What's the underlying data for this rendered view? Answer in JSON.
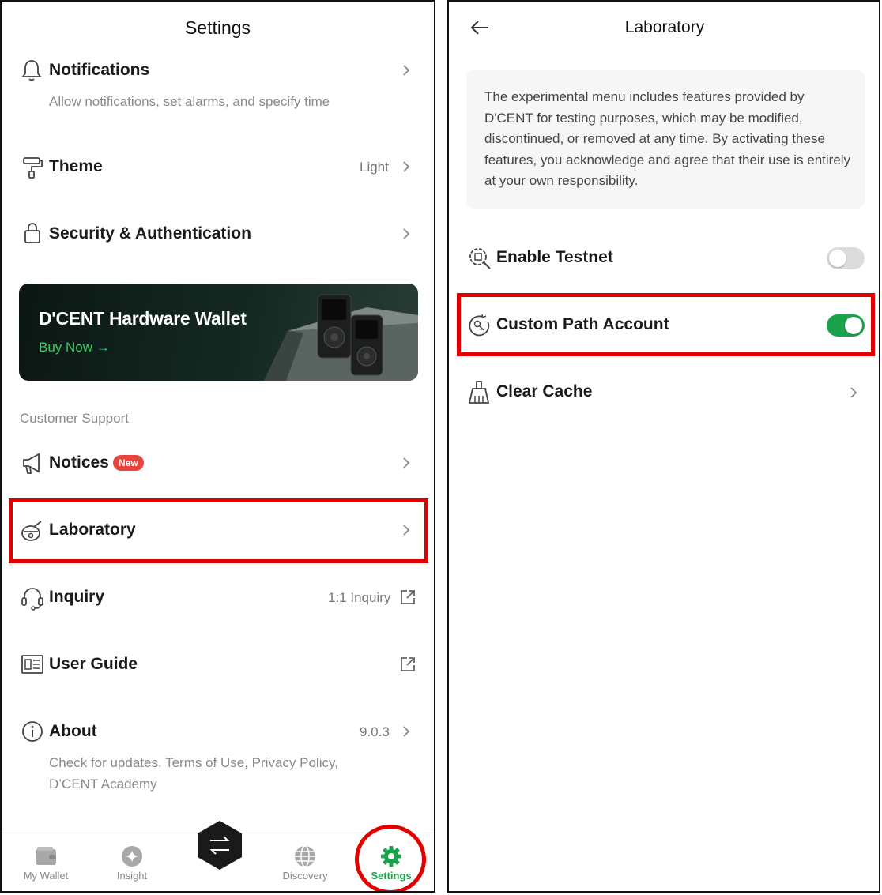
{
  "settings": {
    "title": "Settings",
    "notifications": {
      "label": "Notifications",
      "description": "Allow notifications, set alarms, and specify time"
    },
    "theme": {
      "label": "Theme",
      "value": "Light"
    },
    "security": {
      "label": "Security & Authentication"
    },
    "banner": {
      "title": "D'CENT Hardware Wallet",
      "cta": "Buy Now →"
    },
    "section_header": "Customer Support",
    "notices": {
      "label": "Notices",
      "badge": "New"
    },
    "laboratory": {
      "label": "Laboratory"
    },
    "inquiry": {
      "label": "Inquiry",
      "value": "1:1 Inquiry"
    },
    "user_guide": {
      "label": "User Guide"
    },
    "about": {
      "label": "About",
      "value": "9.0.3",
      "description": "Check for updates, Terms of Use, Privacy Policy, D’CENT Academy"
    }
  },
  "tabbar": {
    "my_wallet": "My Wallet",
    "insight": "Insight",
    "discovery": "Discovery",
    "settings": "Settings",
    "accent_color": "#1aa34a"
  },
  "laboratory_screen": {
    "title": "Laboratory",
    "notice": "The experimental menu includes features provided by D'CENT for testing purposes, which may be modified, discontinued, or removed at any time. By activating these features, you acknowledge and agree that their use is entirely at your own responsibility.",
    "enable_testnet": {
      "label": "Enable Testnet",
      "enabled": false
    },
    "custom_path": {
      "label": "Custom Path Account",
      "enabled": true
    },
    "clear_cache": {
      "label": "Clear Cache"
    }
  },
  "colors": {
    "highlight": "#e30000",
    "toggle_on": "#1aa34a",
    "toggle_off": "#dcdcdc",
    "badge": "#e8443f"
  },
  "icons": [
    "bell-icon",
    "paint-roller-icon",
    "lock-icon",
    "megaphone-icon",
    "flask-icon",
    "headset-icon",
    "book-icon",
    "info-icon",
    "chevron-right-icon",
    "external-link-icon",
    "wallet-icon",
    "sparkle-icon",
    "swap-icon",
    "globe-icon",
    "gear-icon",
    "arrow-left-icon",
    "search-scan-icon",
    "key-refresh-icon",
    "broom-icon"
  ]
}
